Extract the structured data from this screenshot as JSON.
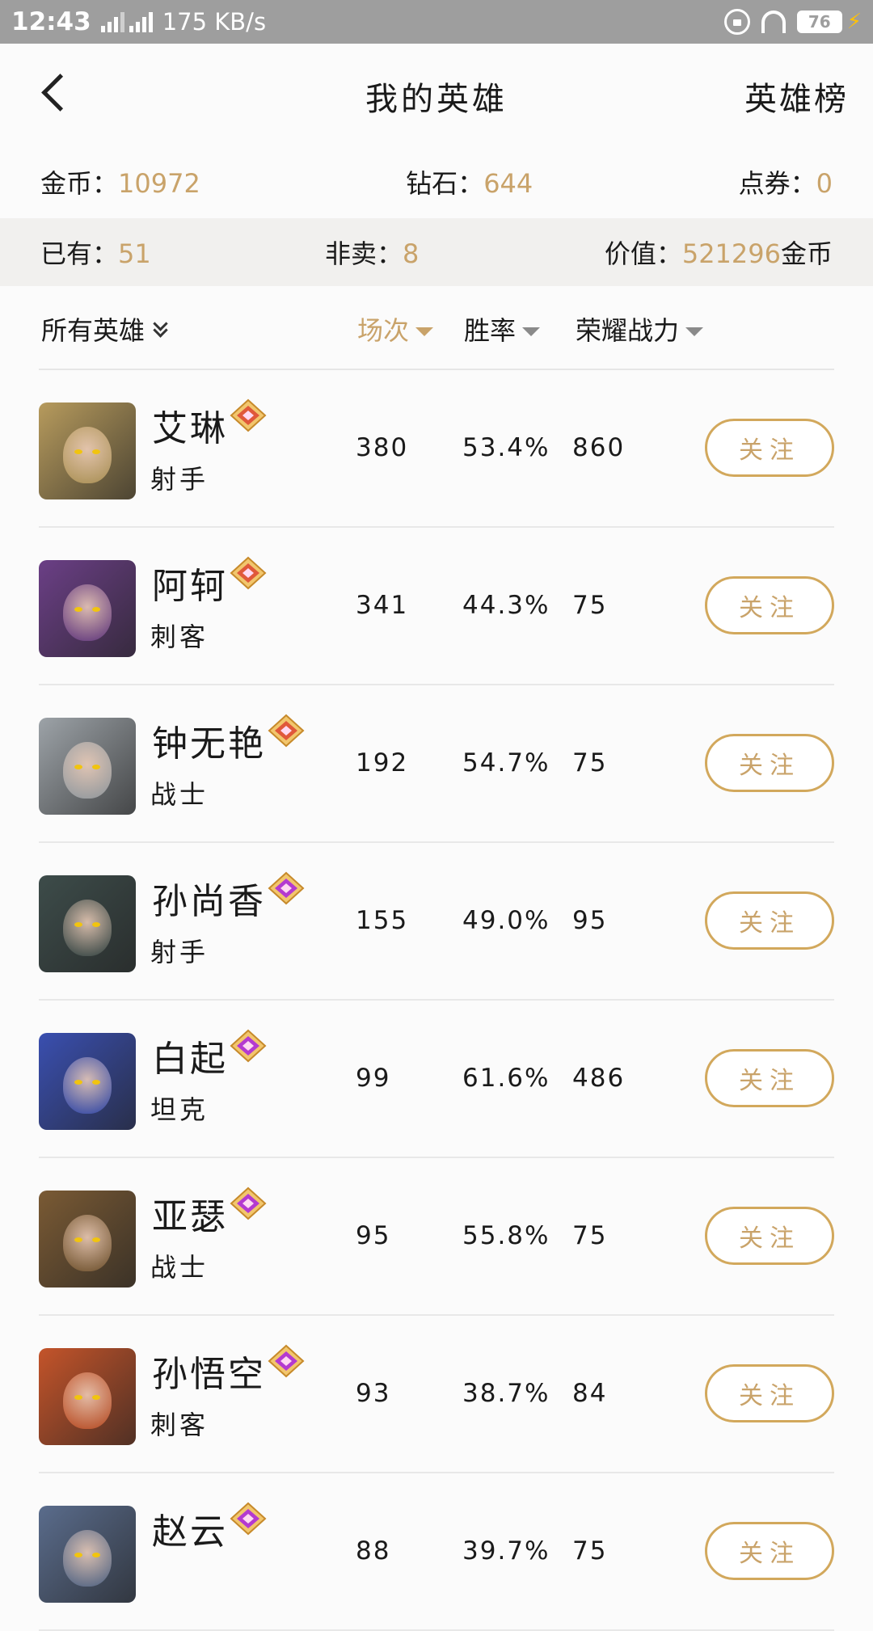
{
  "status": {
    "time": "12:43",
    "net1": "3G",
    "net2": "4G",
    "speed": "175 KB/s",
    "battery": "76"
  },
  "header": {
    "title": "我的英雄",
    "rank_link": "英雄榜"
  },
  "currency": [
    {
      "label": "金币：",
      "value": "10972"
    },
    {
      "label": "钻石：",
      "value": "644"
    },
    {
      "label": "点券：",
      "value": "0"
    }
  ],
  "summary": {
    "owned_label": "已有：",
    "owned_value": "51",
    "notsale_label": "非卖：",
    "notsale_value": "8",
    "worth_label": "价值：",
    "worth_value": "521296",
    "worth_unit": "金币"
  },
  "columns": {
    "all": "所有英雄",
    "games": "场次",
    "winrate": "胜率",
    "power": "荣耀战力"
  },
  "follow_label": "关注",
  "heroes": [
    {
      "name": "艾琳",
      "role": "射手",
      "games": "380",
      "winrate": "53.4%",
      "power": "860",
      "tone": "#b79b5d",
      "badge": "gold"
    },
    {
      "name": "阿轲",
      "role": "刺客",
      "games": "341",
      "winrate": "44.3%",
      "power": "75",
      "tone": "#6b3f86",
      "badge": "gold"
    },
    {
      "name": "钟无艳",
      "role": "战士",
      "games": "192",
      "winrate": "54.7%",
      "power": "75",
      "tone": "#9da3a8",
      "badge": "gold"
    },
    {
      "name": "孙尚香",
      "role": "射手",
      "games": "155",
      "winrate": "49.0%",
      "power": "95",
      "tone": "#3d4c4a",
      "badge": "purple"
    },
    {
      "name": "白起",
      "role": "坦克",
      "games": "99",
      "winrate": "61.6%",
      "power": "486",
      "tone": "#3a4fb0",
      "badge": "purple"
    },
    {
      "name": "亚瑟",
      "role": "战士",
      "games": "95",
      "winrate": "55.8%",
      "power": "75",
      "tone": "#7a5a34",
      "badge": "purple"
    },
    {
      "name": "孙悟空",
      "role": "刺客",
      "games": "93",
      "winrate": "38.7%",
      "power": "84",
      "tone": "#c4542a",
      "badge": "purple"
    },
    {
      "name": "赵云",
      "role": "",
      "games": "88",
      "winrate": "39.7%",
      "power": "75",
      "tone": "#5a6c8c",
      "badge": "purple"
    }
  ]
}
